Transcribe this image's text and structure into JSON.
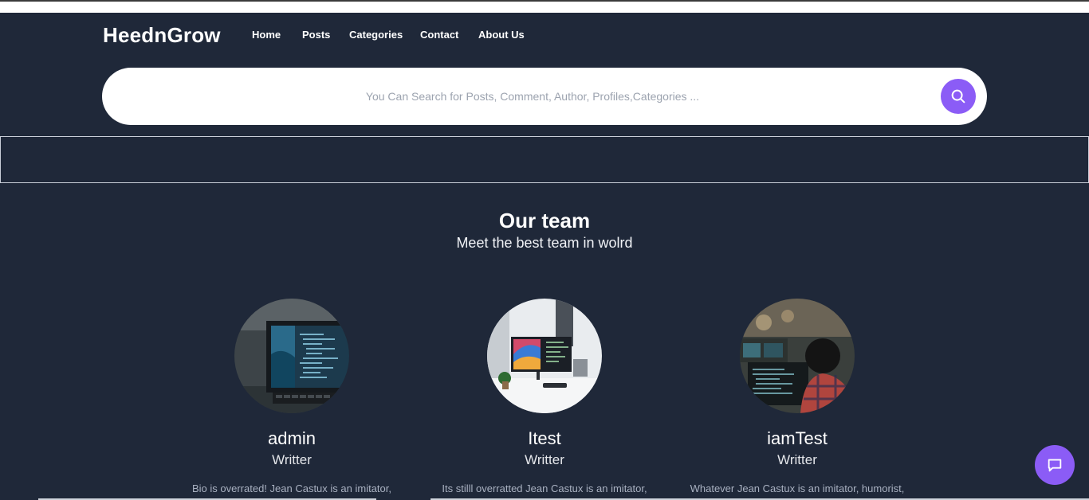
{
  "brand": "HeednGrow",
  "nav": [
    {
      "label": "Home"
    },
    {
      "label": "Posts"
    },
    {
      "label": "Categories"
    },
    {
      "label": "Contact"
    },
    {
      "label": "About Us"
    }
  ],
  "search": {
    "value": "",
    "placeholder": "You Can Search for Posts, Comment, Author, Profiles,Categories ...",
    "icon": "search-icon"
  },
  "team": {
    "title": "Our team",
    "subtitle": "Meet the best team in wolrd",
    "members": [
      {
        "name": "admin",
        "role": "Writter",
        "bio": "Bio is overrated! Jean Castux is an imitator,",
        "photo": "laptop-code-photo"
      },
      {
        "name": "Itest",
        "role": "Writter",
        "bio": "Its stilll overratted Jean Castux is an imitator,",
        "photo": "desk-monitors-photo"
      },
      {
        "name": "iamTest",
        "role": "Writter",
        "bio": "Whatever Jean Castux is an imitator, humorist,",
        "photo": "coder-at-screen-photo"
      }
    ]
  },
  "chat": {
    "icon": "chat-icon"
  },
  "colors": {
    "background": "#1f2839",
    "accent": "#8b5cf6",
    "search_bg": "#ffffff"
  }
}
